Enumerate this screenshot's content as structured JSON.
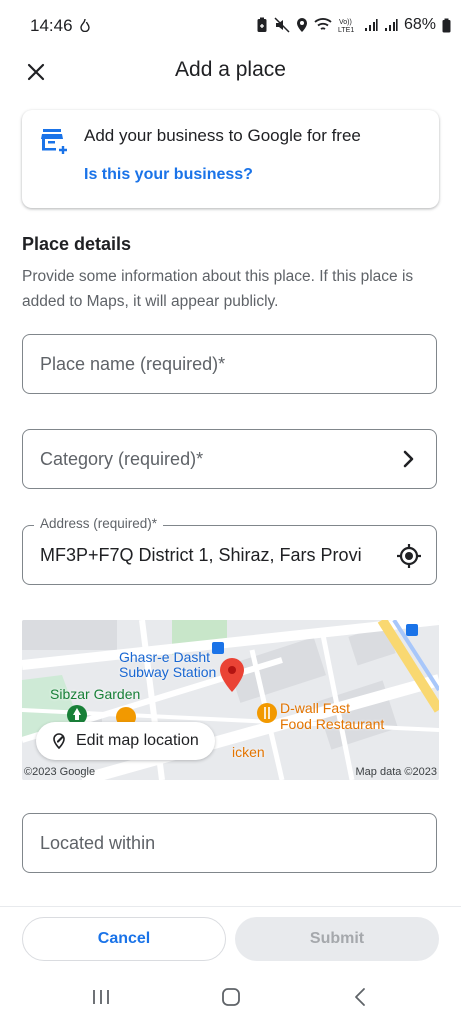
{
  "status_bar": {
    "time": "14:46",
    "battery": "68%",
    "icons": [
      "data-saver-icon",
      "battery-saver-icon",
      "mute-icon",
      "location-icon",
      "wifi-icon",
      "volte-icon",
      "signal-icon",
      "signal-icon",
      "battery-icon"
    ],
    "volte_text": "Vo))\nLTE1"
  },
  "header": {
    "title": "Add a place",
    "close_icon": "close-icon"
  },
  "business_card": {
    "icon": "store-add-icon",
    "text": "Add your business to Google for free",
    "link": "Is this your business?"
  },
  "section": {
    "title": "Place details",
    "description": "Provide some information about this place. If this place is added to Maps, it will appear publicly."
  },
  "fields": {
    "place_name": {
      "placeholder": "Place name (required)*",
      "value": ""
    },
    "category": {
      "placeholder": "Category (required)*",
      "value": "",
      "icon": "chevron-right-icon"
    },
    "address": {
      "label": "Address (required)*",
      "value": "MF3P+F7Q District 1, Shiraz, Fars Provi",
      "icon": "my-location-icon"
    },
    "located_within": {
      "placeholder": "Located within",
      "value": ""
    }
  },
  "map": {
    "labels": {
      "station": "Ghasr-e Dasht\nSubway Station",
      "garden": "Sibzar Garden",
      "restaurant": "D-wall Fast\nFood Restaurant",
      "chicken": "icken"
    },
    "edit_button": "Edit map location",
    "copyright": "©2023 Google",
    "map_data": "Map data ©2023"
  },
  "actions": {
    "cancel": "Cancel",
    "submit": "Submit"
  },
  "colors": {
    "accent": "#1a73e8",
    "pin": "#ea4335",
    "poi_orange": "#f29900",
    "park_green": "#188038"
  }
}
